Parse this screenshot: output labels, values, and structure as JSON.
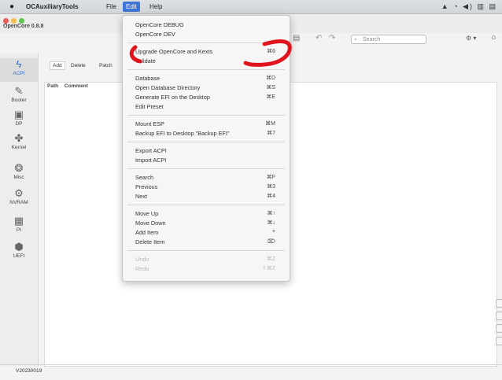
{
  "menubar": {
    "apple_icon": "apple-icon",
    "app_name": "OCAuxiliaryTools",
    "menus": [
      "File",
      "Edit",
      "Help"
    ],
    "active_menu": "Edit",
    "tray_icons": [
      "control-icon",
      "sync-icon",
      "volume-icon",
      "input-icon"
    ]
  },
  "window": {
    "title": "OpenCore 0.8.8",
    "search_placeholder": "Search",
    "toolbar_icons": [
      "database-icon",
      "undo-icon",
      "redo-icon",
      "search-icon",
      "gear-icon"
    ]
  },
  "sidebar": {
    "items": [
      {
        "label": "ACPI",
        "icon": "bolt-icon"
      },
      {
        "label": "Booter",
        "icon": "pin-icon"
      },
      {
        "label": "DP",
        "icon": "display-icon"
      },
      {
        "label": "Kernel",
        "icon": "kernel-icon"
      },
      {
        "label": "Misc",
        "icon": "misc-icon"
      },
      {
        "label": "NVRAM",
        "icon": "nvram-icon"
      },
      {
        "label": "PI",
        "icon": "pi-icon"
      },
      {
        "label": "UEFI",
        "icon": "uefi-icon"
      }
    ]
  },
  "tabs": [
    "Add",
    "Delete",
    "Patch"
  ],
  "columns": [
    "Path",
    "Comment"
  ],
  "version": "V20230019",
  "edit_menu": {
    "items": [
      {
        "label": "OpenCore DEBUG",
        "shortcut": ""
      },
      {
        "label": "OpenCore DEV",
        "shortcut": ""
      },
      {
        "label": "Upgrade OpenCore and Kexts",
        "shortcut": "⌘6"
      },
      {
        "label": "Validate",
        "shortcut": ""
      },
      {
        "label": "Database",
        "shortcut": "⌘D"
      },
      {
        "label": "Open Database Directory",
        "shortcut": "⌘S"
      },
      {
        "label": "Generate EFI on the Desktop",
        "shortcut": "⌘E"
      },
      {
        "label": "Edit Preset",
        "shortcut": ""
      },
      {
        "label": "Mount ESP",
        "shortcut": "⌘M"
      },
      {
        "label": "Backup EFI to Desktop \"Backup EFI\"",
        "shortcut": "⌘7"
      },
      {
        "label": "Export ACPI",
        "shortcut": ""
      },
      {
        "label": "Import ACPI",
        "shortcut": ""
      },
      {
        "label": "Search",
        "shortcut": "⌘F"
      },
      {
        "label": "Previous",
        "shortcut": "⌘3"
      },
      {
        "label": "Next",
        "shortcut": "⌘4"
      },
      {
        "label": "Move Up",
        "shortcut": "⌘↑"
      },
      {
        "label": "Move Down",
        "shortcut": "⌘↓"
      },
      {
        "label": "Add Item",
        "shortcut": "+"
      },
      {
        "label": "Delete Item",
        "shortcut": "⌦"
      },
      {
        "label": "Undo",
        "shortcut": "⌘Z"
      },
      {
        "label": "Redo",
        "shortcut": "⇧⌘Z"
      }
    ]
  },
  "colors": {
    "accent": "#3d74d6",
    "marker": "#e0141c"
  }
}
